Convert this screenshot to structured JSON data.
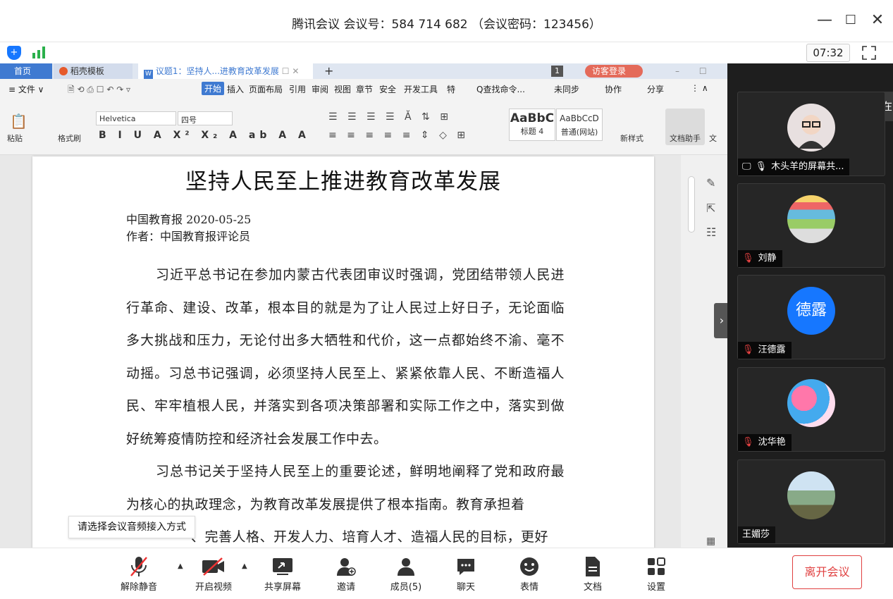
{
  "window": {
    "title": "腾讯会议 会议号：584 714 682 （会议密码：123456）"
  },
  "status": {
    "timer": "07:32"
  },
  "wps": {
    "tabs": {
      "home": "首页",
      "templates": "稻壳模板",
      "doc": "议题1：坚持人...进教育改革发展",
      "page_count": "1",
      "guest_login": "访客登录"
    },
    "menu": {
      "file": "≡ 文件 ∨",
      "start": "开始",
      "insert": "插入",
      "layout": "页面布局",
      "ref": "引用",
      "review": "审阅",
      "view": "视图",
      "chapter": "章节",
      "security": "安全",
      "devtools": "开发工具",
      "more": "特",
      "search": "Q查找命令...",
      "sync": "未同步",
      "collab": "协作",
      "share": "分享"
    },
    "ribbon": {
      "paste": "粘贴",
      "format_painter": "格式刷",
      "font": "Helvetica",
      "size": "四号",
      "style1_sample": "AaBbC",
      "style1_name": "标题 4",
      "style2_sample": "AaBbCcD",
      "style2_name": "普通(网站)",
      "new_style": "新样式",
      "assistant": "文档助手",
      "more": "文"
    }
  },
  "document": {
    "title": "坚持人民至上推进教育改革发展",
    "source": "中国教育报 2020-05-25",
    "author": "作者：中国教育报评论员",
    "para1": "习近平总书记在参加内蒙古代表团审议时强调，党团结带领人民进行革命、建设、改革，根本目的就是为了让人民过上好日子，无论面临多大挑战和压力，无论付出多大牺牲和代价，这一点都始终不渝、毫不动摇。习总书记强调，必须坚持人民至上、紧紧依靠人民、不断造福人民、牢牢植根人民，并落实到各项决策部署和实际工作之中，落实到做好统筹疫情防控和经济社会发展工作中去。",
    "para2": "习总书记关于坚持人民至上的重要论述，鲜明地阐释了党和政府最为核心的执政理念，为教育改革发展提供了根本指南。教育承担着",
    "para3_tail": "、完善人格、开发人力、培育人才、造福人民的目标，更好"
  },
  "tooltip": "请选择会议音频接入方式",
  "participants": [
    {
      "name": "木头羊的屏幕共...",
      "state": "sharing"
    },
    {
      "name": "刘静",
      "state": "muted"
    },
    {
      "name": "汪德露",
      "state": "muted",
      "initials": "德露"
    },
    {
      "name": "沈华艳",
      "state": "muted"
    },
    {
      "name": "王媚莎",
      "state": "none"
    }
  ],
  "partial_label": "正在",
  "toolbar": {
    "unmute": "解除静音",
    "video": "开启视频",
    "share": "共享屏幕",
    "invite": "邀请",
    "members": "成员(5)",
    "chat": "聊天",
    "emoji": "表情",
    "docs": "文档",
    "settings": "设置",
    "leave": "离开会议"
  },
  "colors": {
    "accent": "#1677ff",
    "leave": "#e04040",
    "wps_blue": "#3f7ad1"
  }
}
